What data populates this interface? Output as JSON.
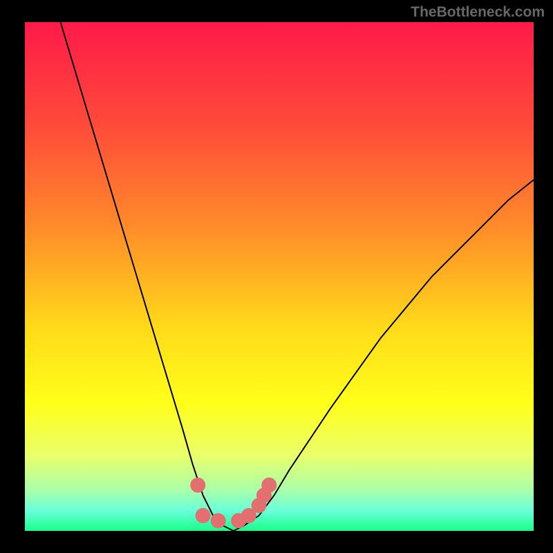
{
  "watermark": "TheBottleneck.com",
  "chart_data": {
    "type": "line",
    "title": "",
    "xlabel": "",
    "ylabel": "",
    "xlim": [
      0,
      100
    ],
    "ylim": [
      0,
      100
    ],
    "curve_points": [
      {
        "x": 7,
        "y": 100
      },
      {
        "x": 10,
        "y": 90
      },
      {
        "x": 13,
        "y": 80
      },
      {
        "x": 16,
        "y": 70
      },
      {
        "x": 19,
        "y": 60
      },
      {
        "x": 22,
        "y": 50
      },
      {
        "x": 25,
        "y": 40
      },
      {
        "x": 28,
        "y": 30
      },
      {
        "x": 31,
        "y": 20
      },
      {
        "x": 33,
        "y": 13
      },
      {
        "x": 35,
        "y": 7
      },
      {
        "x": 37,
        "y": 3
      },
      {
        "x": 39,
        "y": 1
      },
      {
        "x": 41,
        "y": 0
      },
      {
        "x": 43,
        "y": 1
      },
      {
        "x": 46,
        "y": 3
      },
      {
        "x": 49,
        "y": 7
      },
      {
        "x": 52,
        "y": 12
      },
      {
        "x": 56,
        "y": 18
      },
      {
        "x": 60,
        "y": 24
      },
      {
        "x": 65,
        "y": 31
      },
      {
        "x": 70,
        "y": 38
      },
      {
        "x": 75,
        "y": 44
      },
      {
        "x": 80,
        "y": 50
      },
      {
        "x": 85,
        "y": 55
      },
      {
        "x": 90,
        "y": 60
      },
      {
        "x": 95,
        "y": 65
      },
      {
        "x": 100,
        "y": 69
      }
    ],
    "markers": [
      {
        "x": 34,
        "y": 9
      },
      {
        "x": 35,
        "y": 3
      },
      {
        "x": 38,
        "y": 2
      },
      {
        "x": 42,
        "y": 2
      },
      {
        "x": 44,
        "y": 3
      },
      {
        "x": 46,
        "y": 5
      },
      {
        "x": 47,
        "y": 7
      },
      {
        "x": 48,
        "y": 9
      }
    ],
    "gradient_stops": [
      {
        "offset": 0,
        "color": "#ff1a4a"
      },
      {
        "offset": 20,
        "color": "#ff4a3a"
      },
      {
        "offset": 40,
        "color": "#ff8a2a"
      },
      {
        "offset": 60,
        "color": "#ffda1a"
      },
      {
        "offset": 75,
        "color": "#ffff1a"
      },
      {
        "offset": 85,
        "color": "#eaff6a"
      },
      {
        "offset": 92,
        "color": "#aaffaa"
      },
      {
        "offset": 96,
        "color": "#6affda"
      },
      {
        "offset": 100,
        "color": "#1aff8a"
      }
    ],
    "marker_color": "#e37070",
    "curve_color": "#000000"
  }
}
